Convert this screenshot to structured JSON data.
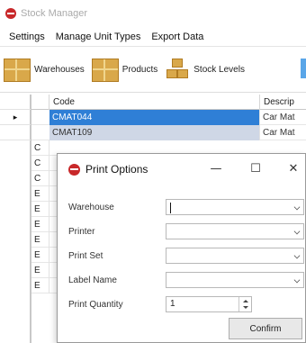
{
  "app": {
    "title": "Stock Manager"
  },
  "menu": [
    "Settings",
    "Manage Unit Types",
    "Export Data"
  ],
  "toolbar": {
    "warehouses_label": "Warehouses",
    "products_label": "Products",
    "stock_levels_label": "Stock Levels"
  },
  "grid": {
    "columns": {
      "code": "Code",
      "description": "Descrip"
    },
    "rows": [
      {
        "code": "CMAT044",
        "description": "Car Mat"
      },
      {
        "code": "CMAT109",
        "description": "Car Mat"
      }
    ],
    "current_row_marker": "▸",
    "row_header_letters": [
      "C",
      "C",
      "C",
      "E",
      "E",
      "E",
      "E",
      "E",
      "E",
      "E"
    ]
  },
  "dialog": {
    "title": "Print Options",
    "minimize": "—",
    "maximize": "☐",
    "close": "✕",
    "fields": {
      "warehouse_label": "Warehouse",
      "warehouse_value": "",
      "printer_label": "Printer",
      "printer_value": "",
      "print_set_label": "Print Set",
      "print_set_value": "",
      "label_name_label": "Label Name",
      "label_name_value": "",
      "print_quantity_label": "Print Quantity",
      "print_quantity_value": "1"
    },
    "confirm_label": "Confirm"
  },
  "colors": {
    "selection": "#2f7fd6",
    "selection_secondary": "#cfd7e6",
    "brand_red": "#c8282a"
  }
}
